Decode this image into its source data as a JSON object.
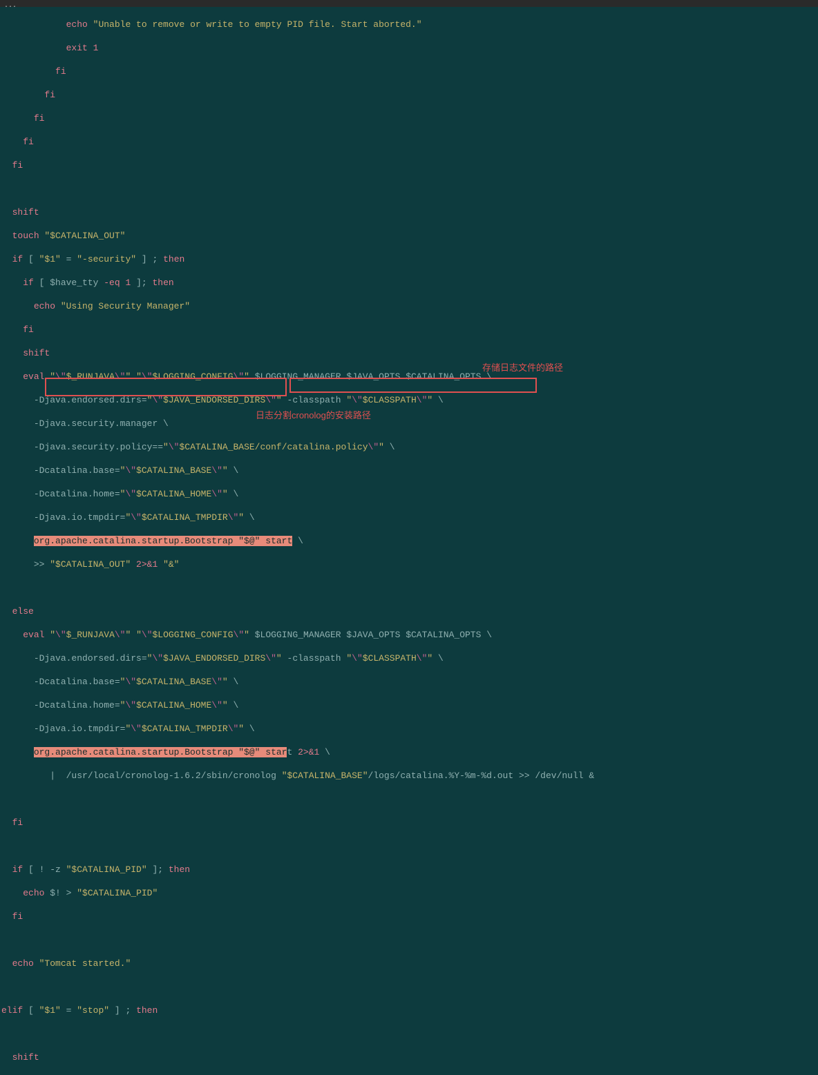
{
  "titlebar": "...",
  "lines": {
    "l1a": "echo ",
    "l1b": "\"Unable to remove or write to empty PID file. Start aborted.\"",
    "l2a": "exit 1",
    "l3": "fi",
    "l4": "fi",
    "l5": "fi",
    "l6": "fi",
    "l7": "fi",
    "l8": "",
    "l9": "shift",
    "l10a": "touch ",
    "l10b": "\"$CATALINA_OUT\"",
    "l11a": "if ",
    "l11b": "[ ",
    "l11c": "\"$1\"",
    "l11d": " = ",
    "l11e": "\"-security\"",
    "l11f": " ] ; ",
    "l11g": "then",
    "l12a": "if ",
    "l12b": "[ $have_tty ",
    "l12c": "-eq 1 ",
    "l12d": "]; ",
    "l12e": "then",
    "l13a": "echo ",
    "l13b": "\"Using Security Manager\"",
    "l14": "fi",
    "l15": "shift",
    "l16a": "eval ",
    "l16b": "\"",
    "l16c": "\\\"",
    "l16d": "$_RUNJAVA",
    "l16e": "\\\"",
    "l16f": "\" \"",
    "l16g": "\\\"",
    "l16h": "$LOGGING_CONFIG",
    "l16i": "\\\"",
    "l16j": "\"",
    "l16k": " $LOGGING_MANAGER $JAVA_OPTS $CATALINA_OPTS \\",
    "l17a": "-Djava.endorsed.dirs=",
    "l17b": "\"",
    "l17c": "\\\"",
    "l17d": "$JAVA_ENDORSED_DIRS",
    "l17e": "\\\"",
    "l17f": "\"",
    "l17g": " -classpath ",
    "l17h": "\"",
    "l17i": "\\\"",
    "l17j": "$CLASSPATH",
    "l17k": "\\\"",
    "l17l": "\"",
    "l17m": " \\",
    "l18a": "-Djava.security.manager \\",
    "l19a": "-Djava.security.policy==",
    "l19b": "\"",
    "l19c": "\\\"",
    "l19d": "$CATALINA_BASE/conf/catalina.policy",
    "l19e": "\\\"",
    "l19f": "\"",
    "l19g": " \\",
    "l20a": "-Dcatalina.base=",
    "l20b": "\"",
    "l20c": "\\\"",
    "l20d": "$CATALINA_BASE",
    "l20e": "\\\"",
    "l20f": "\"",
    "l20g": " \\",
    "l21a": "-Dcatalina.home=",
    "l21b": "\"",
    "l21c": "\\\"",
    "l21d": "$CATALINA_HOME",
    "l21e": "\\\"",
    "l21f": "\"",
    "l21g": " \\",
    "l22a": "-Djava.io.tmpdir=",
    "l22b": "\"",
    "l22c": "\\\"",
    "l22d": "$CATALINA_TMPDIR",
    "l22e": "\\\"",
    "l22f": "\"",
    "l22g": " \\",
    "l23a": "org.apache.catalina.startup.Bootstrap \"$@\" start",
    "l23b": " \\",
    "l24a": ">> ",
    "l24b": "\"$CATALINA_OUT\"",
    "l24c": " 2>&1 ",
    "l24d": "\"&\"",
    "l25": "",
    "l26": "else",
    "l27a": "eval ",
    "l27b": "\"",
    "l27c": "\\\"",
    "l27d": "$_RUNJAVA",
    "l27e": "\\\"",
    "l27f": "\" \"",
    "l27g": "\\\"",
    "l27h": "$LOGGING_CONFIG",
    "l27i": "\\\"",
    "l27j": "\"",
    "l27k": " $LOGGING_MANAGER $JAVA_OPTS $CATALINA_OPTS \\",
    "l28a": "-Djava.endorsed.dirs=",
    "l28b": "\"",
    "l28c": "\\\"",
    "l28d": "$JAVA_ENDORSED_DIRS",
    "l28e": "\\\"",
    "l28f": "\"",
    "l28g": " -classpath ",
    "l28h": "\"",
    "l28i": "\\\"",
    "l28j": "$CLASSPATH",
    "l28k": "\\\"",
    "l28l": "\"",
    "l28m": " \\",
    "l29a": "-Dcatalina.base=",
    "l29b": "\"",
    "l29c": "\\\"",
    "l29d": "$CATALINA_BASE",
    "l29e": "\\\"",
    "l29f": "\"",
    "l29g": " \\",
    "l30a": "-Dcatalina.home=",
    "l30b": "\"",
    "l30c": "\\\"",
    "l30d": "$CATALINA_HOME",
    "l30e": "\\\"",
    "l30f": "\"",
    "l30g": " \\",
    "l31a": "-Djava.io.tmpdir=",
    "l31b": "\"",
    "l31c": "\\\"",
    "l31d": "$CATALINA_TMPDIR",
    "l31e": "\\\"",
    "l31f": "\"",
    "l31g": " \\",
    "l32a": "org.apache.catalina.startup.Bootstrap \"$@\" star",
    "l32a2": "t",
    "l32b": " 2>&1 ",
    "l32c": "\\",
    "l33a": "|  /usr/local/cronolog-1.6.2/sbin/cronolog ",
    "l33b": "\"$CATALINA_BASE\"",
    "l33c": "/logs/catalina.%Y-%m-%d.out",
    "l33d": " >> /dev/null &",
    "l34": "",
    "l35": "fi",
    "l36": "",
    "l37a": "if ",
    "l37b": "[ ! -z ",
    "l37c": "\"$CATALINA_PID\"",
    "l37d": " ]; ",
    "l37e": "then",
    "l38a": "echo ",
    "l38b": "$! > ",
    "l38c": "\"$CATALINA_PID\"",
    "l39": "fi",
    "l40": "",
    "l41a": "echo ",
    "l41b": "\"Tomcat started.\"",
    "l42": "",
    "l43a": "elif ",
    "l43b": "[ ",
    "l43c": "\"$1\"",
    "l43d": " = ",
    "l43e": "\"stop\"",
    "l43f": " ] ; ",
    "l43g": "then",
    "l44": "",
    "l45": "shift"
  },
  "annotations": {
    "ann1": "存储日志文件的路径",
    "ann2": "日志分割cronolog的安装路径"
  }
}
